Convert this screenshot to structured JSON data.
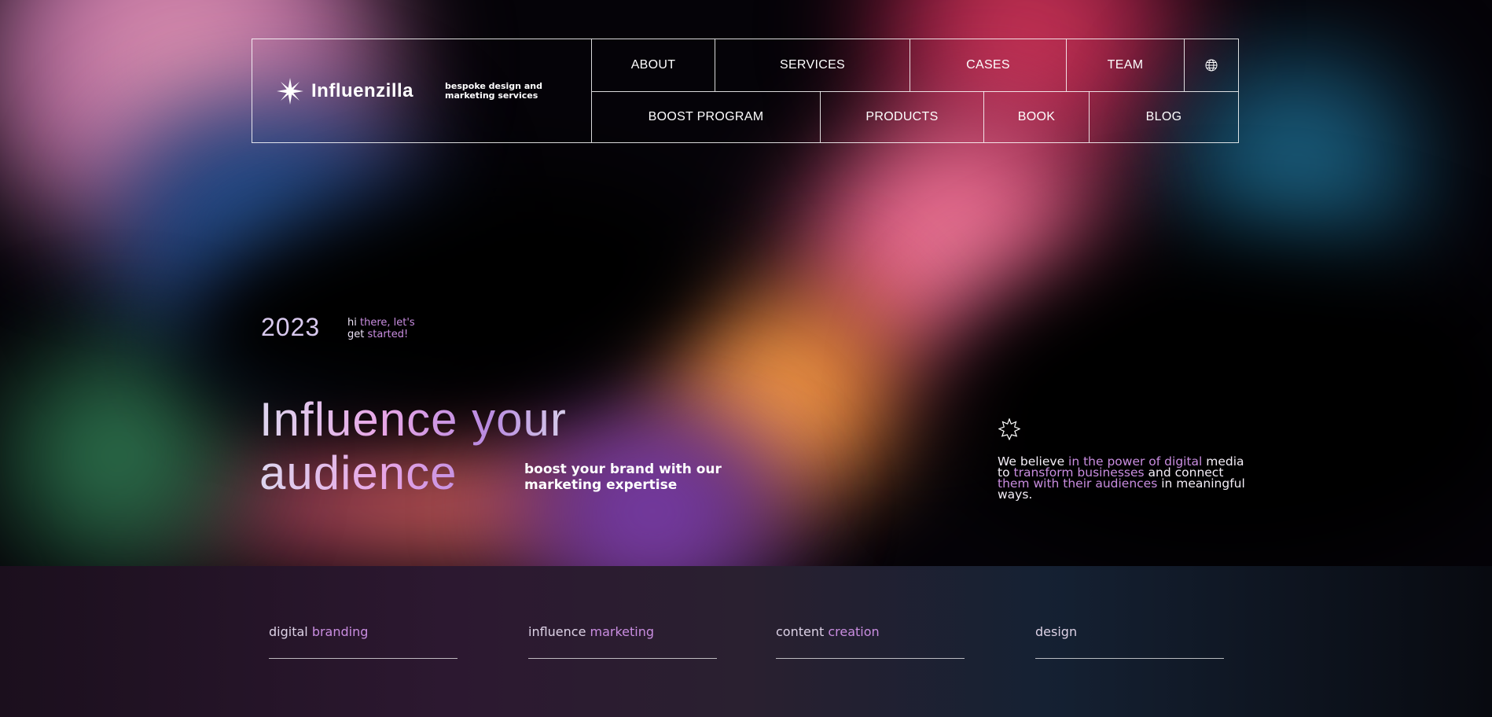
{
  "brand": {
    "name": "Influenzilla",
    "tagline": "bespoke design and marketing services"
  },
  "nav": {
    "row1": [
      "ABOUT",
      "SERVICES",
      "CASES",
      "TEAM"
    ],
    "row2": [
      "BOOST PROGRAM",
      "PRODUCTS",
      "BOOK",
      "BLOG"
    ],
    "globe_icon": "globe-icon"
  },
  "hero": {
    "year": "2023",
    "greeting": {
      "a": "hi ",
      "b": "there, let's",
      "c": "get ",
      "d": "started!"
    },
    "headline": {
      "line1": "Influence your",
      "line2": "audience"
    },
    "subheadline": "boost your brand with our marketing expertise",
    "belief": {
      "p1": "We believe ",
      "p2": "in the power of digital",
      "p3": " media to ",
      "p4": "transform businesses",
      "p5": " and connect ",
      "p6": "them with their audiences",
      "p7": " in meaningful ways."
    }
  },
  "services": [
    {
      "a": "digital ",
      "b": "branding"
    },
    {
      "a": "influence ",
      "b": "marketing"
    },
    {
      "a": "content ",
      "b": "creation"
    },
    {
      "a": "design",
      "b": ""
    }
  ],
  "colors": {
    "accent": "#c98de0",
    "text": "#ffffff",
    "background": "#050308"
  }
}
